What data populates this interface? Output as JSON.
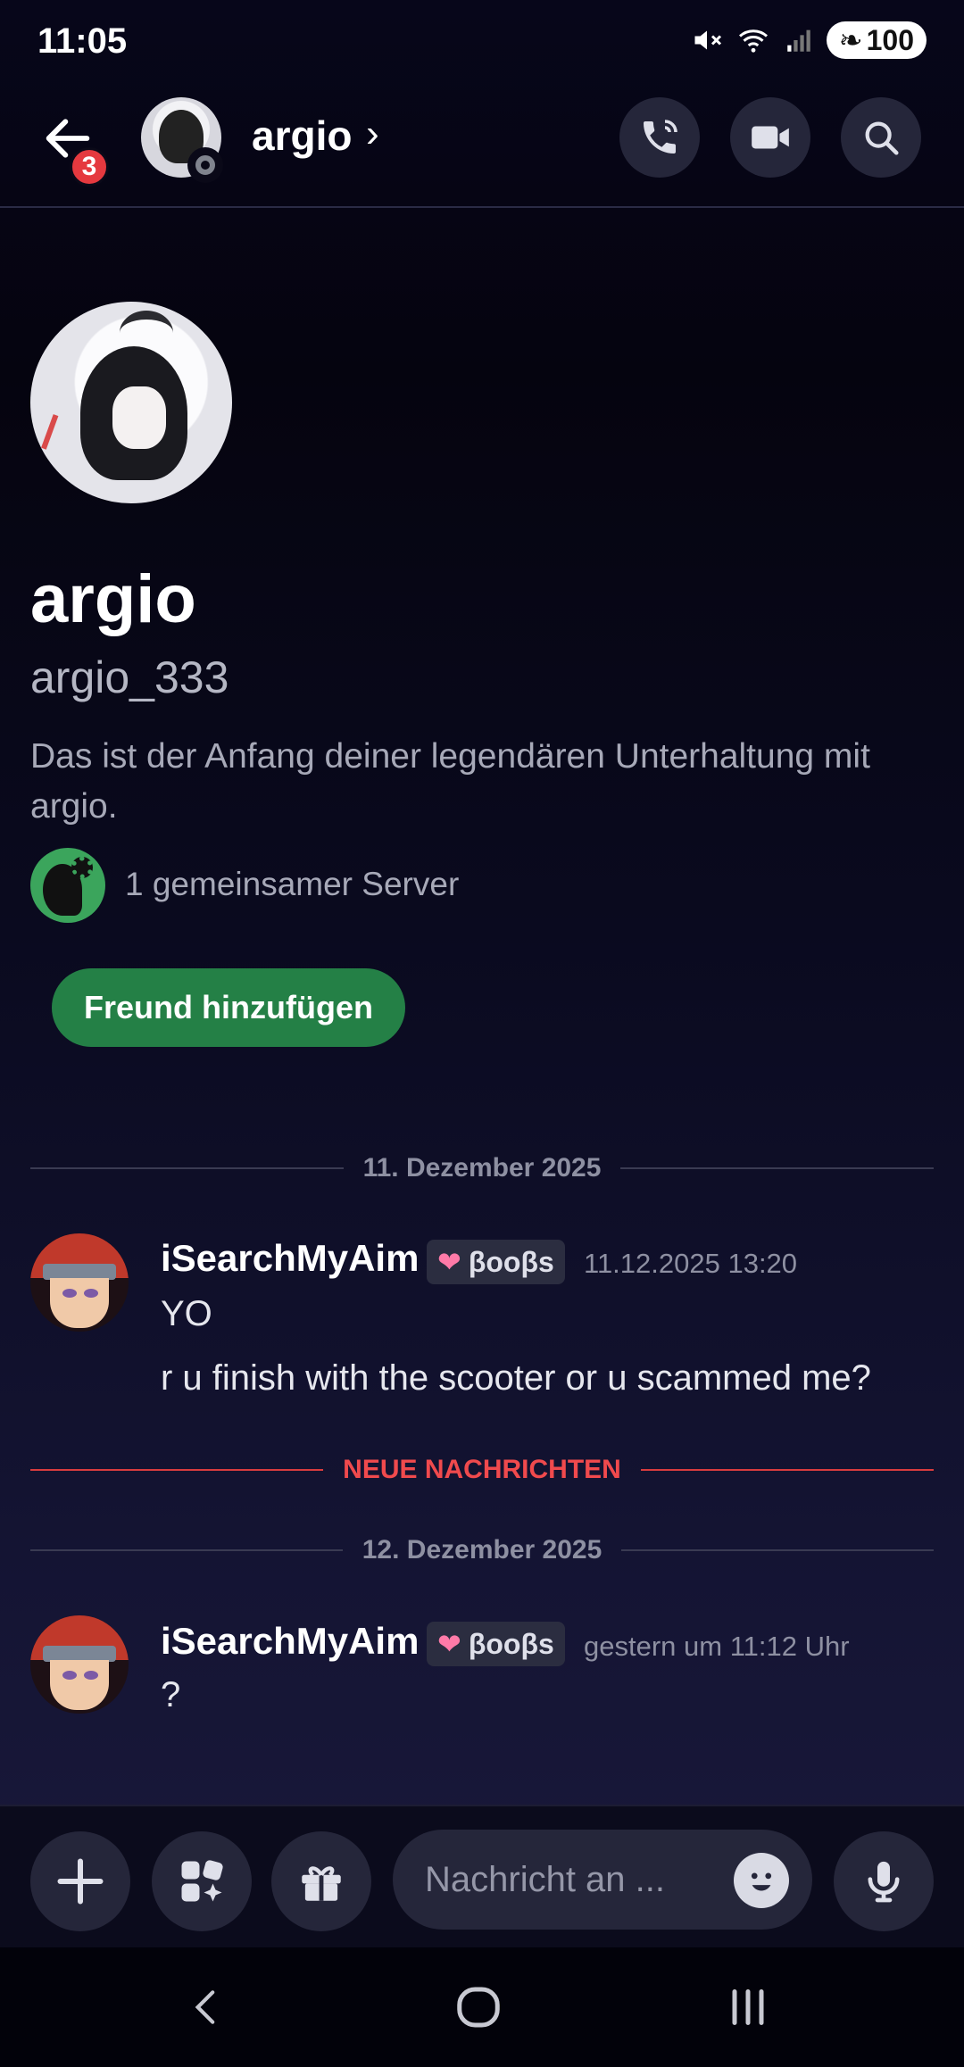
{
  "status_bar": {
    "time": "11:05",
    "battery": "100"
  },
  "header": {
    "back_badge_count": "3",
    "name": "argio"
  },
  "profile": {
    "display_name": "argio",
    "username": "argio_333",
    "intro": "Das ist der Anfang deiner legendären Unterhaltung mit argio.",
    "mutual_servers": "1 gemeinsamer Server",
    "add_friend_label": "Freund hinzufügen"
  },
  "dividers": {
    "date1": "11. Dezember 2025",
    "new_messages": "NEUE NACHRICHTEN",
    "date2": "12. Dezember 2025"
  },
  "messages": [
    {
      "author": "iSearchMyAim",
      "tag": "βooβs",
      "timestamp": "11.12.2025 13:20",
      "lines": [
        "YO",
        "r u finish with the scooter or u scammed me?"
      ]
    },
    {
      "author": "iSearchMyAim",
      "tag": "βooβs",
      "timestamp": "gestern um 11:12 Uhr",
      "lines": [
        "?"
      ]
    }
  ],
  "composer": {
    "placeholder": "Nachricht an ..."
  },
  "colors": {
    "add_friend": "#248046",
    "new_messages": "#f04a4d",
    "badge": "#e5393f",
    "server_icon": "#3ba55c"
  }
}
